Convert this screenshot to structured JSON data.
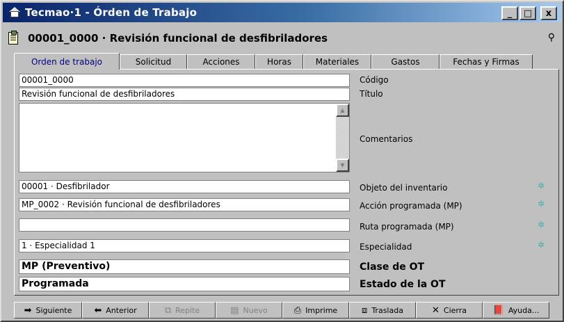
{
  "window": {
    "title": "Tecmao·1 - Órden de Trabajo",
    "min": "_",
    "max": "□",
    "close": "x"
  },
  "header": {
    "title": "00001_0000 · Revisión funcional de desfibriladores",
    "search_icon": "binoculars-icon"
  },
  "tabs": [
    {
      "label": "Orden de trabajo",
      "active": true
    },
    {
      "label": "Solicitud"
    },
    {
      "label": "Acciones"
    },
    {
      "label": "Horas"
    },
    {
      "label": "Materiales"
    },
    {
      "label": "Gastos"
    },
    {
      "label": "Fechas y Firmas"
    }
  ],
  "form": {
    "codigo": {
      "value": "00001_0000",
      "label": "Código"
    },
    "titulo": {
      "value": "Revisión funcional de desfibriladores",
      "label": "Título"
    },
    "comentarios": {
      "value": "",
      "label": "Comentarios"
    },
    "objeto": {
      "value": "00001 · Desfibrilador",
      "label": "Objeto del inventario"
    },
    "accion": {
      "value": "MP_0002 · Revisión funcional de desfibriladores",
      "label": "Acción programada (MP)"
    },
    "ruta": {
      "value": "",
      "label": "Ruta programada (MP)"
    },
    "especialidad": {
      "value": "1 · Especialidad 1",
      "label": "Especialidad"
    },
    "clase": {
      "value": "MP (Preventivo)",
      "label": "Clase de OT"
    },
    "estado": {
      "value": "Programada",
      "label": "Estado de la OT"
    }
  },
  "toolbar": {
    "siguiente": "Siguiente",
    "anterior": "Anterior",
    "repite": "Repite",
    "nuevo": "Nuevo",
    "imprime": "Imprime",
    "traslada": "Traslada",
    "cierra": "Cierra",
    "ayuda": "Ayuda..."
  },
  "colors": {
    "titlebar_start": "#0a246a",
    "titlebar_end": "#a6caf0",
    "active_tab_text": "#000080",
    "gear": "#40b0b0"
  }
}
